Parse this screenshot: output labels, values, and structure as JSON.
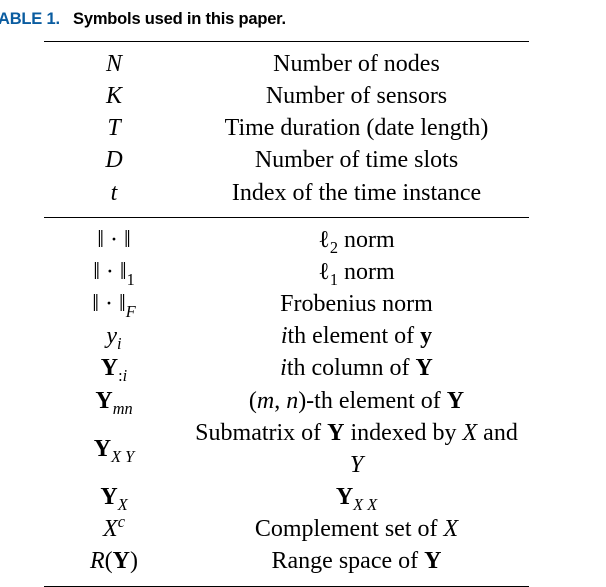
{
  "caption": {
    "label_prefix": "ABLE 1.",
    "text": "Symbols used in this paper."
  },
  "groups": [
    {
      "rows": [
        {
          "sym_html": "<span class='it'>N</span>",
          "desc_html": "Number of nodes"
        },
        {
          "sym_html": "<span class='it'>K</span>",
          "desc_html": "Number of sensors"
        },
        {
          "sym_html": "<span class='it'>T</span>",
          "desc_html": "Time duration (date length)"
        },
        {
          "sym_html": "<span class='it'>D</span>",
          "desc_html": "Number of time slots"
        },
        {
          "sym_html": "<span class='it'>t</span>",
          "desc_html": "Index of the time instance"
        }
      ]
    },
    {
      "rows": [
        {
          "sym_html": "‖ · ‖",
          "desc_html": "ℓ<sub>2</sub> norm"
        },
        {
          "sym_html": "‖ · ‖<sub>1</sub>",
          "desc_html": "ℓ<sub>1</sub> norm"
        },
        {
          "sym_html": "‖ · ‖<sub><span class='it'>F</span></sub>",
          "desc_html": "Frobenius norm"
        },
        {
          "sym_html": "<span class='it'>y</span><sub><span class='it'>i</span></sub>",
          "desc_html": "<span class='it'>i</span>th element of <span class='bf'>y</span>"
        },
        {
          "sym_html": "<span class='bf'>Y</span><sub>:<span class='it'>i</span></sub>",
          "desc_html": "<span class='it'>i</span>th column of <span class='bf'>Y</span>"
        },
        {
          "sym_html": "<span class='bf'>Y</span><sub><span class='it'>mn</span></sub>",
          "desc_html": "(<span class='it'>m</span>, <span class='it'>n</span>)-th element of <span class='bf'>Y</span>"
        },
        {
          "sym_html": "<span class='bf'>Y</span><sub><span class='cal'>X Y</span></sub>",
          "desc_html": "Submatrix of <span class='bf'>Y</span> indexed by <span class='cal'>X</span> and <span class='cal'>Y</span>"
        },
        {
          "sym_html": "<span class='bf'>Y</span><sub><span class='cal'>X</span></sub>",
          "desc_html": "<span class='bf'>Y</span><sub><span class='cal'>X X</span></sub>"
        },
        {
          "sym_html": "<span class='cal'>X</span><sup><span class='it'>c</span></sup>",
          "desc_html": "Complement set of <span class='cal'>X</span>"
        },
        {
          "sym_html": "<span class='cal'>R</span>(<span class='bf'>Y</span>)",
          "desc_html": "Range space of <span class='bf'>Y</span>"
        }
      ]
    }
  ]
}
